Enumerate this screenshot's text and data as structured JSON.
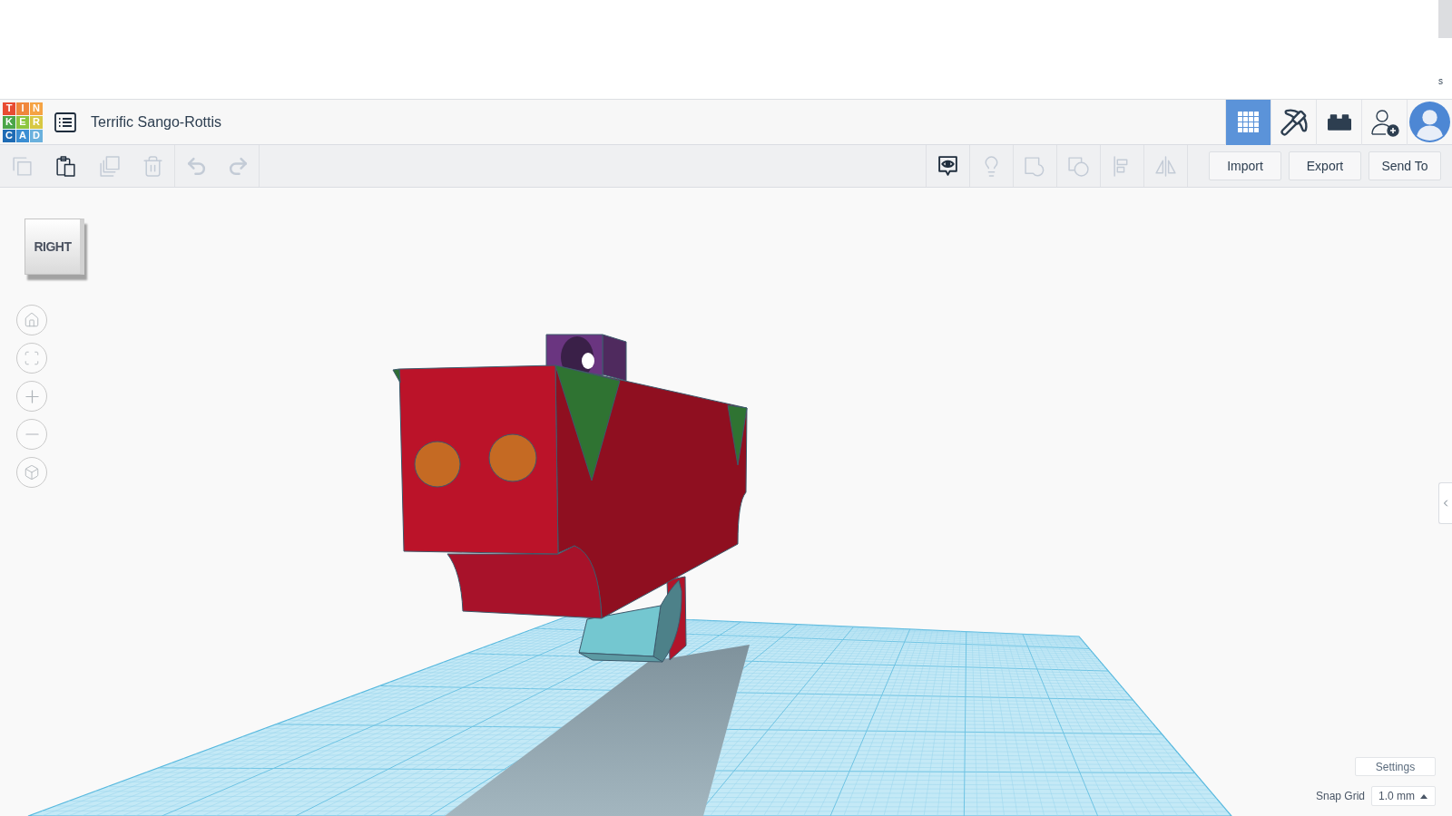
{
  "page_top": {
    "corner_text": "s"
  },
  "header": {
    "logo_tiles": [
      {
        "letter": "T",
        "color": "#e84c32"
      },
      {
        "letter": "I",
        "color": "#f0873c"
      },
      {
        "letter": "N",
        "color": "#f5a343"
      },
      {
        "letter": "K",
        "color": "#4ba548"
      },
      {
        "letter": "E",
        "color": "#8cc63f"
      },
      {
        "letter": "R",
        "color": "#d7c843"
      },
      {
        "letter": "C",
        "color": "#1e6bb4"
      },
      {
        "letter": "A",
        "color": "#3b8ed3"
      },
      {
        "letter": "D",
        "color": "#6ab1dd"
      }
    ],
    "title": "Terrific Sango-Rottis",
    "view_buttons": [
      {
        "kind": "grid",
        "selected": true
      },
      {
        "kind": "pickaxe",
        "selected": false
      },
      {
        "kind": "bricks",
        "selected": false
      }
    ]
  },
  "toolbar": {
    "edit_tools": [
      {
        "kind": "copy",
        "disabled": true
      },
      {
        "kind": "paste",
        "disabled": false
      },
      {
        "kind": "duplicate",
        "disabled": true
      },
      {
        "kind": "delete",
        "disabled": true
      }
    ],
    "history_tools": [
      {
        "kind": "undo",
        "disabled": true
      },
      {
        "kind": "redo",
        "disabled": true
      }
    ],
    "shape_tools": [
      {
        "kind": "notes",
        "disabled": false
      },
      {
        "kind": "bulb",
        "disabled": true
      },
      {
        "kind": "group",
        "disabled": true
      },
      {
        "kind": "hole",
        "disabled": true
      },
      {
        "kind": "align",
        "disabled": true
      },
      {
        "kind": "mirror",
        "disabled": true
      }
    ],
    "buttons": [
      "Import",
      "Export",
      "Send To"
    ]
  },
  "viewport": {
    "view_cube": "RIGHT",
    "nav_buttons": [
      {
        "kind": "home"
      },
      {
        "kind": "fit"
      },
      {
        "kind": "zoom_in"
      },
      {
        "kind": "zoom_out"
      },
      {
        "kind": "perspective"
      }
    ],
    "settings_button": "Settings",
    "snap_grid": {
      "label": "Snap Grid",
      "value": "1.0 mm"
    }
  }
}
